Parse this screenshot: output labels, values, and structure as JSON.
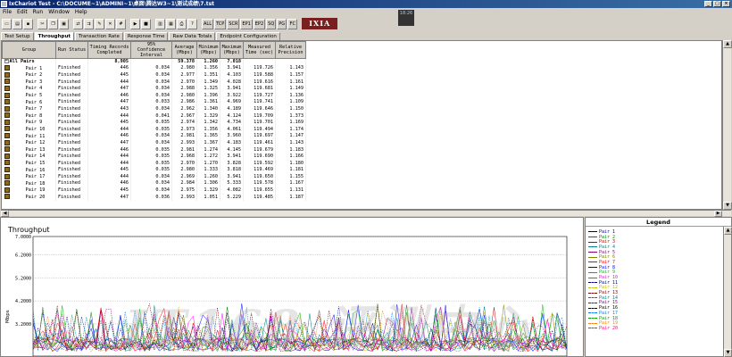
{
  "window": {
    "title": "IxChariot Test - C:\\DOCUME~1\\ADMINI~1\\桌面\\腾达W3~1\\测试成绩\\7.tst"
  },
  "menu": [
    "File",
    "Edit",
    "Run",
    "Window",
    "Help"
  ],
  "toolbar": {
    "buttons": [
      "ALL",
      "TCP",
      "SCR",
      "EP1",
      "EP2",
      "SQ",
      "PG",
      "FC"
    ],
    "logo": "IXIA",
    "corner_box": "18:26"
  },
  "tabs": [
    "Test Setup",
    "Throughput",
    "Transaction Rate",
    "Response Time",
    "Raw Data Totals",
    "Endpoint Configuration"
  ],
  "active_tab": "Throughput",
  "table": {
    "headers": [
      "Group",
      "Run Status",
      "Timing Records\nCompleted",
      "95% Confidence\nInterval",
      "Average\n(Mbps)",
      "Minimum\n(Mbps)",
      "Maximum\n(Mbps)",
      "Measured\nTime (sec)",
      "Relative\nPrecision"
    ],
    "all_pairs": {
      "label": "All Pairs",
      "records": "8,905",
      "average": "59.378",
      "minimum": "1.260",
      "maximum": "7.018"
    },
    "rows": [
      {
        "pair": "Pair 1",
        "status": "Finished",
        "records": "446",
        "ci": "0.034",
        "avg": "2.980",
        "min": "1.356",
        "max": "3.941",
        "time": "119.726",
        "prec": "1.143"
      },
      {
        "pair": "Pair 2",
        "status": "Finished",
        "records": "445",
        "ci": "0.034",
        "avg": "2.977",
        "min": "1.351",
        "max": "4.103",
        "time": "119.588",
        "prec": "1.157"
      },
      {
        "pair": "Pair 3",
        "status": "Finished",
        "records": "444",
        "ci": "0.034",
        "avg": "2.970",
        "min": "1.349",
        "max": "4.028",
        "time": "119.616",
        "prec": "1.161"
      },
      {
        "pair": "Pair 4",
        "status": "Finished",
        "records": "447",
        "ci": "0.034",
        "avg": "2.988",
        "min": "1.325",
        "max": "3.941",
        "time": "119.681",
        "prec": "1.149"
      },
      {
        "pair": "Pair 5",
        "status": "Finished",
        "records": "446",
        "ci": "0.034",
        "avg": "2.980",
        "min": "1.396",
        "max": "3.922",
        "time": "119.727",
        "prec": "1.136"
      },
      {
        "pair": "Pair 6",
        "status": "Finished",
        "records": "447",
        "ci": "0.033",
        "avg": "2.986",
        "min": "1.361",
        "max": "4.969",
        "time": "119.741",
        "prec": "1.109"
      },
      {
        "pair": "Pair 7",
        "status": "Finished",
        "records": "443",
        "ci": "0.034",
        "avg": "2.962",
        "min": "1.340",
        "max": "4.189",
        "time": "119.646",
        "prec": "1.150"
      },
      {
        "pair": "Pair 8",
        "status": "Finished",
        "records": "444",
        "ci": "0.041",
        "avg": "2.967",
        "min": "1.329",
        "max": "4.124",
        "time": "119.709",
        "prec": "1.373"
      },
      {
        "pair": "Pair 9",
        "status": "Finished",
        "records": "445",
        "ci": "0.035",
        "avg": "2.974",
        "min": "1.342",
        "max": "4.734",
        "time": "119.701",
        "prec": "1.169"
      },
      {
        "pair": "Pair 10",
        "status": "Finished",
        "records": "444",
        "ci": "0.035",
        "avg": "2.973",
        "min": "1.356",
        "max": "4.061",
        "time": "119.494",
        "prec": "1.174"
      },
      {
        "pair": "Pair 11",
        "status": "Finished",
        "records": "446",
        "ci": "0.034",
        "avg": "2.981",
        "min": "1.365",
        "max": "3.960",
        "time": "119.697",
        "prec": "1.147"
      },
      {
        "pair": "Pair 12",
        "status": "Finished",
        "records": "447",
        "ci": "0.034",
        "avg": "2.993",
        "min": "1.367",
        "max": "4.183",
        "time": "119.461",
        "prec": "1.143"
      },
      {
        "pair": "Pair 13",
        "status": "Finished",
        "records": "446",
        "ci": "0.035",
        "avg": "2.981",
        "min": "1.274",
        "max": "4.145",
        "time": "119.679",
        "prec": "1.183"
      },
      {
        "pair": "Pair 14",
        "status": "Finished",
        "records": "444",
        "ci": "0.035",
        "avg": "2.968",
        "min": "1.272",
        "max": "3.941",
        "time": "119.690",
        "prec": "1.166"
      },
      {
        "pair": "Pair 15",
        "status": "Finished",
        "records": "444",
        "ci": "0.035",
        "avg": "2.970",
        "min": "1.270",
        "max": "3.828",
        "time": "119.592",
        "prec": "1.180"
      },
      {
        "pair": "Pair 16",
        "status": "Finished",
        "records": "445",
        "ci": "0.035",
        "avg": "2.980",
        "min": "1.333",
        "max": "3.818",
        "time": "119.469",
        "prec": "1.181"
      },
      {
        "pair": "Pair 17",
        "status": "Finished",
        "records": "444",
        "ci": "0.034",
        "avg": "2.969",
        "min": "1.260",
        "max": "3.941",
        "time": "119.650",
        "prec": "1.155"
      },
      {
        "pair": "Pair 18",
        "status": "Finished",
        "records": "446",
        "ci": "0.034",
        "avg": "2.984",
        "min": "1.306",
        "max": "5.333",
        "time": "119.578",
        "prec": "1.167"
      },
      {
        "pair": "Pair 19",
        "status": "Finished",
        "records": "445",
        "ci": "0.034",
        "avg": "2.975",
        "min": "1.329",
        "max": "4.082",
        "time": "119.655",
        "prec": "1.131"
      },
      {
        "pair": "Pair 20",
        "status": "Finished",
        "records": "447",
        "ci": "0.036",
        "avg": "2.993",
        "min": "1.051",
        "max": "5.229",
        "time": "119.485",
        "prec": "1.187"
      }
    ]
  },
  "chart": {
    "title": "Throughput",
    "ylabel": "Mbps",
    "watermark": "IT168 评测中心"
  },
  "chart_data": {
    "type": "line",
    "title": "Throughput",
    "ylabel": "Mbps",
    "ylim": [
      1.8,
      7.0
    ],
    "yticks": [
      "7.0000",
      "6.2000",
      "5.2000",
      "4.2000",
      "3.2000"
    ],
    "series_count": 20
  },
  "legend": {
    "title": "Legend",
    "items": [
      {
        "name": "Pair 1",
        "color": "#000080",
        "dash": "solid"
      },
      {
        "name": "Pair 2",
        "color": "#008000",
        "dash": "solid"
      },
      {
        "name": "Pair 3",
        "color": "#c00000",
        "dash": "solid"
      },
      {
        "name": "Pair 4",
        "color": "#008080",
        "dash": "solid"
      },
      {
        "name": "Pair 5",
        "color": "#800080",
        "dash": "solid"
      },
      {
        "name": "Pair 6",
        "color": "#808000",
        "dash": "solid"
      },
      {
        "name": "Pair 7",
        "color": "#ff0000",
        "dash": "solid"
      },
      {
        "name": "Pair 8",
        "color": "#0000ff",
        "dash": "solid"
      },
      {
        "name": "Pair 9",
        "color": "#00c000",
        "dash": "solid"
      },
      {
        "name": "Pair 10",
        "color": "#ff00ff",
        "dash": "solid"
      },
      {
        "name": "Pair 11",
        "color": "#000080",
        "dash": "dashed"
      },
      {
        "name": "Pair 12",
        "color": "#c0c000",
        "dash": "dashed"
      },
      {
        "name": "Pair 13",
        "color": "#800000",
        "dash": "dashed"
      },
      {
        "name": "Pair 14",
        "color": "#008080",
        "dash": "dashed"
      },
      {
        "name": "Pair 15",
        "color": "#800080",
        "dash": "dashed"
      },
      {
        "name": "Pair 16",
        "color": "#000000",
        "dash": "dashed"
      },
      {
        "name": "Pair 17",
        "color": "#0080ff",
        "dash": "dashed"
      },
      {
        "name": "Pair 18",
        "color": "#00a000",
        "dash": "dashed"
      },
      {
        "name": "Pair 19",
        "color": "#ff8000",
        "dash": "dashed"
      },
      {
        "name": "Pair 20",
        "color": "#ff0080",
        "dash": "dashed"
      }
    ]
  }
}
